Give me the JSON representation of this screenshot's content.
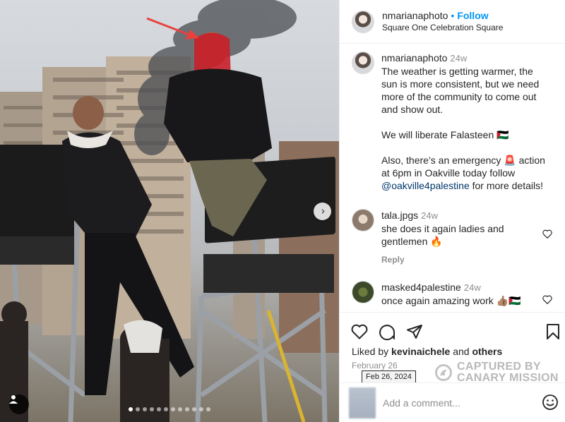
{
  "post": {
    "username": "nmarianaphoto",
    "separator": "•",
    "follow_label": "Follow",
    "location": "Square One Celebration Square"
  },
  "comments": [
    {
      "username": "nmarianaphoto",
      "time": "24w",
      "text": "The weather is getting warmer, the sun is more consistent, but we need more of the community to come out and show out.\n\nWe will liberate Falasteen 🇵🇸\n\nAlso, there’s an emergency 🚨 action at 6pm in Oakville today follow",
      "mention": "@oakville4palestine",
      "text_after": " for more details!"
    },
    {
      "username": "tala.jpgs",
      "time": "24w",
      "text": "she does it again ladies and gentlemen 🔥",
      "reply_label": "Reply"
    },
    {
      "username": "masked4palestine",
      "time": "24w",
      "text": "once again amazing work 👍🏽🇵🇸"
    }
  ],
  "actions": {
    "liked_by_prefix": "Liked by",
    "liked_by_user": "kevinaichele",
    "liked_by_and": "and",
    "liked_by_others": "others",
    "date": "February 26",
    "date_tooltip": "Feb 26, 2024"
  },
  "watermark": {
    "line1": "CAPTURED BY",
    "line2": "CANARY MISSION"
  },
  "add_comment": {
    "placeholder": "Add a comment..."
  },
  "carousel": {
    "slide_count": 12,
    "active_index": 0
  },
  "icons": [
    "heart-icon",
    "comment-icon",
    "share-icon",
    "bookmark-icon",
    "emoji-icon",
    "chevron-right-icon",
    "user-tag-icon"
  ],
  "colors": {
    "link_blue": "#0095f6",
    "mention_blue": "#00376b",
    "annotation_arrow": "#e8413d"
  }
}
